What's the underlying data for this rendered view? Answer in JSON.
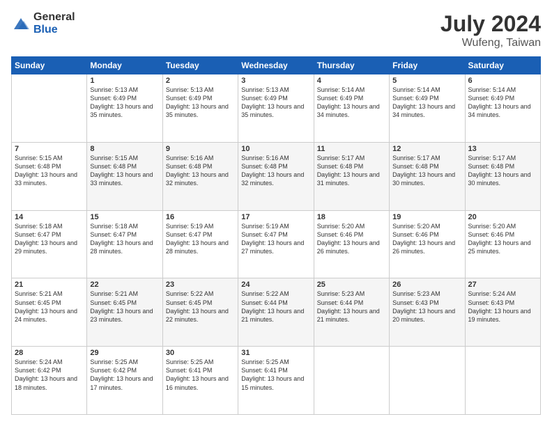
{
  "header": {
    "logo_general": "General",
    "logo_blue": "Blue",
    "month_year": "July 2024",
    "location": "Wufeng, Taiwan"
  },
  "weekdays": [
    "Sunday",
    "Monday",
    "Tuesday",
    "Wednesday",
    "Thursday",
    "Friday",
    "Saturday"
  ],
  "weeks": [
    [
      {
        "day": "",
        "sunrise": "",
        "sunset": "",
        "daylight": ""
      },
      {
        "day": "1",
        "sunrise": "Sunrise: 5:13 AM",
        "sunset": "Sunset: 6:49 PM",
        "daylight": "Daylight: 13 hours and 35 minutes."
      },
      {
        "day": "2",
        "sunrise": "Sunrise: 5:13 AM",
        "sunset": "Sunset: 6:49 PM",
        "daylight": "Daylight: 13 hours and 35 minutes."
      },
      {
        "day": "3",
        "sunrise": "Sunrise: 5:13 AM",
        "sunset": "Sunset: 6:49 PM",
        "daylight": "Daylight: 13 hours and 35 minutes."
      },
      {
        "day": "4",
        "sunrise": "Sunrise: 5:14 AM",
        "sunset": "Sunset: 6:49 PM",
        "daylight": "Daylight: 13 hours and 34 minutes."
      },
      {
        "day": "5",
        "sunrise": "Sunrise: 5:14 AM",
        "sunset": "Sunset: 6:49 PM",
        "daylight": "Daylight: 13 hours and 34 minutes."
      },
      {
        "day": "6",
        "sunrise": "Sunrise: 5:14 AM",
        "sunset": "Sunset: 6:49 PM",
        "daylight": "Daylight: 13 hours and 34 minutes."
      }
    ],
    [
      {
        "day": "7",
        "sunrise": "Sunrise: 5:15 AM",
        "sunset": "Sunset: 6:48 PM",
        "daylight": "Daylight: 13 hours and 33 minutes."
      },
      {
        "day": "8",
        "sunrise": "Sunrise: 5:15 AM",
        "sunset": "Sunset: 6:48 PM",
        "daylight": "Daylight: 13 hours and 33 minutes."
      },
      {
        "day": "9",
        "sunrise": "Sunrise: 5:16 AM",
        "sunset": "Sunset: 6:48 PM",
        "daylight": "Daylight: 13 hours and 32 minutes."
      },
      {
        "day": "10",
        "sunrise": "Sunrise: 5:16 AM",
        "sunset": "Sunset: 6:48 PM",
        "daylight": "Daylight: 13 hours and 32 minutes."
      },
      {
        "day": "11",
        "sunrise": "Sunrise: 5:17 AM",
        "sunset": "Sunset: 6:48 PM",
        "daylight": "Daylight: 13 hours and 31 minutes."
      },
      {
        "day": "12",
        "sunrise": "Sunrise: 5:17 AM",
        "sunset": "Sunset: 6:48 PM",
        "daylight": "Daylight: 13 hours and 30 minutes."
      },
      {
        "day": "13",
        "sunrise": "Sunrise: 5:17 AM",
        "sunset": "Sunset: 6:48 PM",
        "daylight": "Daylight: 13 hours and 30 minutes."
      }
    ],
    [
      {
        "day": "14",
        "sunrise": "Sunrise: 5:18 AM",
        "sunset": "Sunset: 6:47 PM",
        "daylight": "Daylight: 13 hours and 29 minutes."
      },
      {
        "day": "15",
        "sunrise": "Sunrise: 5:18 AM",
        "sunset": "Sunset: 6:47 PM",
        "daylight": "Daylight: 13 hours and 28 minutes."
      },
      {
        "day": "16",
        "sunrise": "Sunrise: 5:19 AM",
        "sunset": "Sunset: 6:47 PM",
        "daylight": "Daylight: 13 hours and 28 minutes."
      },
      {
        "day": "17",
        "sunrise": "Sunrise: 5:19 AM",
        "sunset": "Sunset: 6:47 PM",
        "daylight": "Daylight: 13 hours and 27 minutes."
      },
      {
        "day": "18",
        "sunrise": "Sunrise: 5:20 AM",
        "sunset": "Sunset: 6:46 PM",
        "daylight": "Daylight: 13 hours and 26 minutes."
      },
      {
        "day": "19",
        "sunrise": "Sunrise: 5:20 AM",
        "sunset": "Sunset: 6:46 PM",
        "daylight": "Daylight: 13 hours and 26 minutes."
      },
      {
        "day": "20",
        "sunrise": "Sunrise: 5:20 AM",
        "sunset": "Sunset: 6:46 PM",
        "daylight": "Daylight: 13 hours and 25 minutes."
      }
    ],
    [
      {
        "day": "21",
        "sunrise": "Sunrise: 5:21 AM",
        "sunset": "Sunset: 6:45 PM",
        "daylight": "Daylight: 13 hours and 24 minutes."
      },
      {
        "day": "22",
        "sunrise": "Sunrise: 5:21 AM",
        "sunset": "Sunset: 6:45 PM",
        "daylight": "Daylight: 13 hours and 23 minutes."
      },
      {
        "day": "23",
        "sunrise": "Sunrise: 5:22 AM",
        "sunset": "Sunset: 6:45 PM",
        "daylight": "Daylight: 13 hours and 22 minutes."
      },
      {
        "day": "24",
        "sunrise": "Sunrise: 5:22 AM",
        "sunset": "Sunset: 6:44 PM",
        "daylight": "Daylight: 13 hours and 21 minutes."
      },
      {
        "day": "25",
        "sunrise": "Sunrise: 5:23 AM",
        "sunset": "Sunset: 6:44 PM",
        "daylight": "Daylight: 13 hours and 21 minutes."
      },
      {
        "day": "26",
        "sunrise": "Sunrise: 5:23 AM",
        "sunset": "Sunset: 6:43 PM",
        "daylight": "Daylight: 13 hours and 20 minutes."
      },
      {
        "day": "27",
        "sunrise": "Sunrise: 5:24 AM",
        "sunset": "Sunset: 6:43 PM",
        "daylight": "Daylight: 13 hours and 19 minutes."
      }
    ],
    [
      {
        "day": "28",
        "sunrise": "Sunrise: 5:24 AM",
        "sunset": "Sunset: 6:42 PM",
        "daylight": "Daylight: 13 hours and 18 minutes."
      },
      {
        "day": "29",
        "sunrise": "Sunrise: 5:25 AM",
        "sunset": "Sunset: 6:42 PM",
        "daylight": "Daylight: 13 hours and 17 minutes."
      },
      {
        "day": "30",
        "sunrise": "Sunrise: 5:25 AM",
        "sunset": "Sunset: 6:41 PM",
        "daylight": "Daylight: 13 hours and 16 minutes."
      },
      {
        "day": "31",
        "sunrise": "Sunrise: 5:25 AM",
        "sunset": "Sunset: 6:41 PM",
        "daylight": "Daylight: 13 hours and 15 minutes."
      },
      {
        "day": "",
        "sunrise": "",
        "sunset": "",
        "daylight": ""
      },
      {
        "day": "",
        "sunrise": "",
        "sunset": "",
        "daylight": ""
      },
      {
        "day": "",
        "sunrise": "",
        "sunset": "",
        "daylight": ""
      }
    ]
  ]
}
